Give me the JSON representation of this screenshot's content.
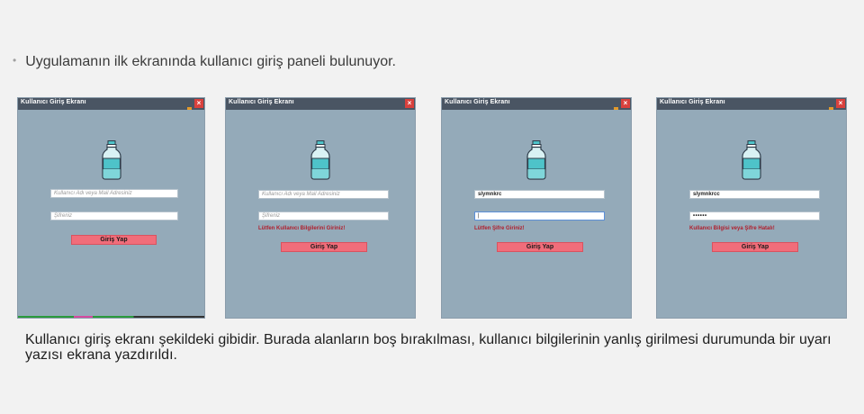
{
  "bullet_text": "Uygulamanın ilk ekranında kullanıcı giriş paneli bulunuyor.",
  "caption": "Kullanıcı giriş ekranı şekildeki gibidir. Burada alanların boş bırakılması, kullanıcı bilgilerinin yanlış girilmesi durumunda bir uyarı yazısı ekrana yazdırıldı.",
  "colors": {
    "window_bg": "#94aab9",
    "titlebar": "#4a5563",
    "close": "#d9413d",
    "button": "#f16d7a",
    "warning": "#b01e2c"
  },
  "close_glyph": "×",
  "windows": [
    {
      "title": "Kullanıcı Giriş Ekranı",
      "username": "Kullanıcı Adı veya Mail Adresiniz",
      "password": "Şifreniz",
      "warning": "",
      "button": "Giriş Yap"
    },
    {
      "title": "Kullanıcı Giriş Ekranı",
      "username": "Kullanıcı Adı veya Mail Adresiniz",
      "password": "Şifreniz",
      "warning": "Lütfen Kullanıcı Bilgilerini Giriniz!",
      "button": "Giriş Yap"
    },
    {
      "title": "Kullanıcı Giriş Ekranı",
      "username": "slymnkrc",
      "password": "|",
      "warning": "Lütfen Şifre Giriniz!",
      "button": "Giriş Yap"
    },
    {
      "title": "Kullanıcı Giriş Ekranı",
      "username": "slymnkrcc",
      "password": "••••••",
      "warning": "Kullanıcı Bilgisi veya Şifre Hatalı!",
      "button": "Giriş Yap"
    }
  ]
}
